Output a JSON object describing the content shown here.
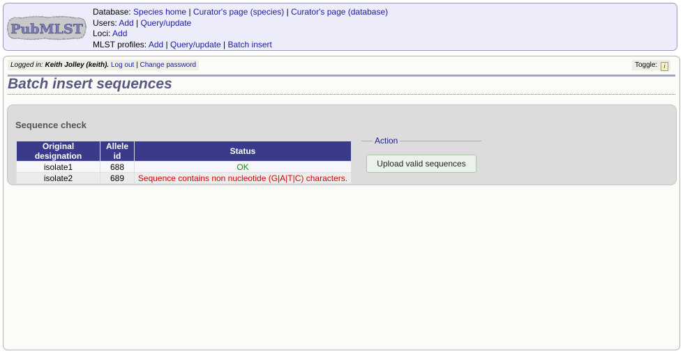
{
  "header": {
    "logo_text": "PubMLST",
    "database": {
      "label": "Database:",
      "links": [
        "Species home",
        "Curator's page (species)",
        "Curator's page (database)"
      ]
    },
    "users": {
      "label": "Users:",
      "links": [
        "Add",
        "Query/update"
      ]
    },
    "loci": {
      "label": "Loci:",
      "links": [
        "Add"
      ]
    },
    "mlst_profiles": {
      "label": "MLST profiles:",
      "links": [
        "Add",
        "Query/update",
        "Batch insert"
      ]
    },
    "separator": "|"
  },
  "login": {
    "label": "Logged in:",
    "user": "Keith Jolley (keith).",
    "logout": "Log out",
    "separator": "|",
    "change_password": "Change password"
  },
  "toggle": {
    "label": "Toggle:",
    "icon": "i"
  },
  "page_title": "Batch insert sequences",
  "sequence_check": {
    "heading": "Sequence check",
    "columns": [
      "Original designation",
      "Allele id",
      "Status"
    ],
    "rows": [
      {
        "designation": "isolate1",
        "allele_id": "688",
        "status": "OK"
      },
      {
        "designation": "isolate2",
        "allele_id": "689",
        "status": "Sequence contains non nucleotide (G|A|T|C) characters."
      }
    ]
  },
  "action": {
    "legend": "Action",
    "button": "Upload valid sequences"
  },
  "colors": {
    "header_bg": "#ececfb",
    "table_header": "#3a3a8a",
    "ok": "#1a8a1a",
    "error": "#d80000",
    "title": "#585880"
  }
}
